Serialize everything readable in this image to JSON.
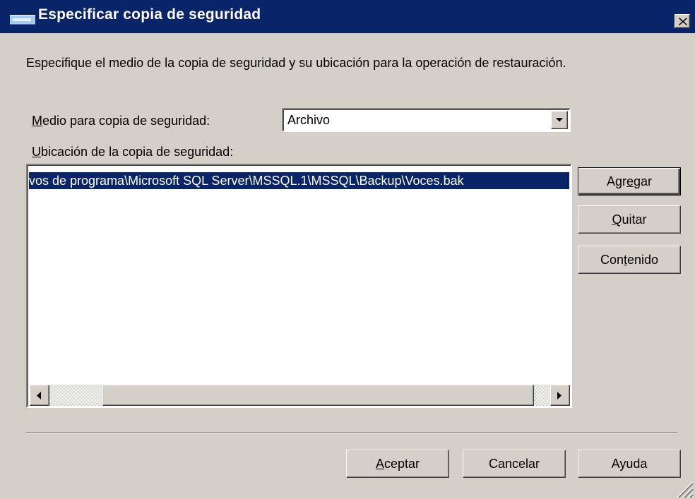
{
  "window": {
    "title": "Especificar copia de seguridad",
    "close_label": "×"
  },
  "description": "Especifique el medio de la copia de seguridad y su ubicación para la operación de restauración.",
  "medium": {
    "label_mnemonic": "M",
    "label_rest": "edio para copia de seguridad:",
    "selected": "Archivo"
  },
  "location": {
    "label_mnemonic": "U",
    "label_rest": "bicación de la copia de seguridad:",
    "items": [
      "vos de programa\\Microsoft SQL Server\\MSSQL.1\\MSSQL\\Backup\\Voces.bak"
    ]
  },
  "side_buttons": {
    "add": {
      "pre": "Agr",
      "mnemonic": "e",
      "post": "gar"
    },
    "remove": {
      "pre": "",
      "mnemonic": "Q",
      "post": "uitar"
    },
    "contents": {
      "pre": "Con",
      "mnemonic": "t",
      "post": "enido"
    }
  },
  "footer_buttons": {
    "ok": {
      "pre": "",
      "mnemonic": "A",
      "post": "ceptar"
    },
    "cancel": "Cancelar",
    "help": "Ayuda"
  },
  "colors": {
    "titlebar": "#0a246a",
    "face": "#d4d0c8",
    "selection": "#0a246a"
  }
}
